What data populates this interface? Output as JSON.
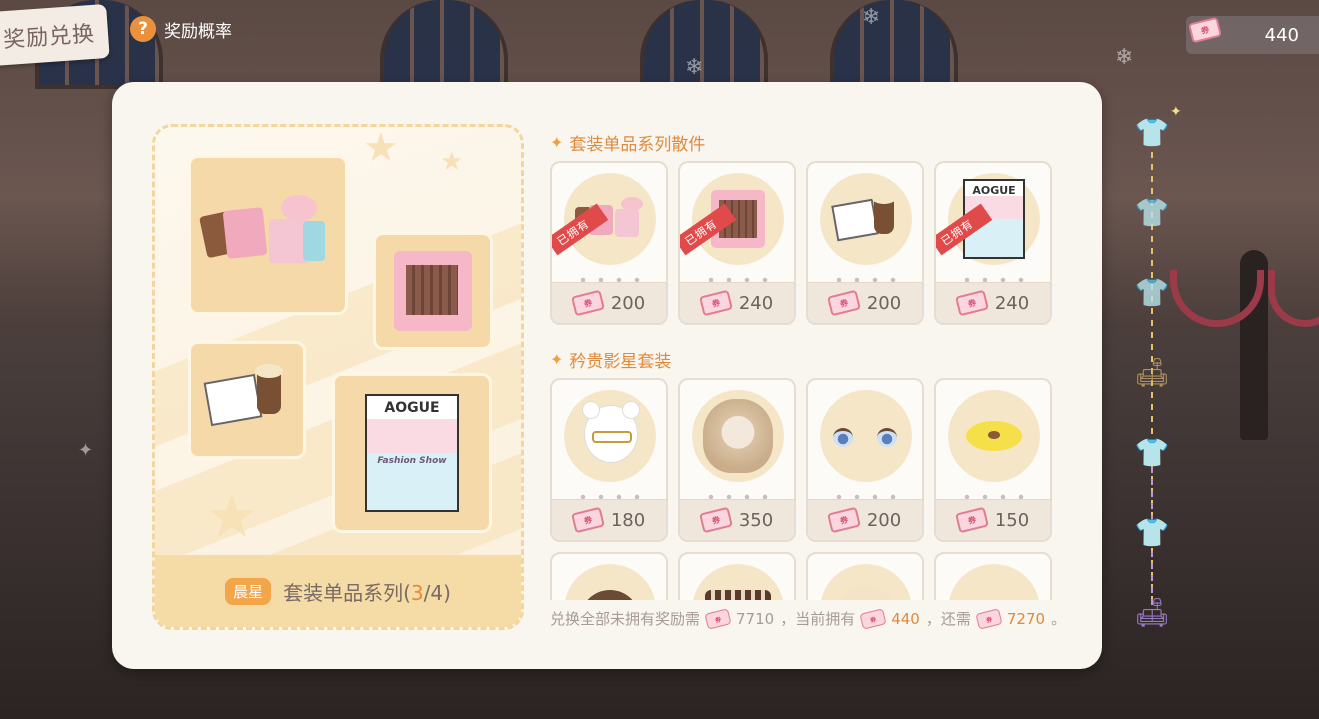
{
  "header": {
    "title": "奖励兑换",
    "help_label": "奖励概率",
    "currency_value": "440"
  },
  "preview": {
    "badge": "晨星",
    "set_name": "套装单品系列(",
    "set_owned": "3",
    "set_sep": "/",
    "set_total": "4",
    "set_close": ")",
    "magazine_title": "AOGUE",
    "magazine_sub": "Fashion Show"
  },
  "section1": {
    "title": "套装单品系列散件",
    "items": [
      {
        "price": "200",
        "owned": true,
        "icon": "shopping-bags-icon"
      },
      {
        "price": "240",
        "owned": true,
        "icon": "wardrobe-box-icon"
      },
      {
        "price": "200",
        "owned": false,
        "icon": "magazine-coffee-icon"
      },
      {
        "price": "240",
        "owned": true,
        "icon": "magazine-icon"
      }
    ]
  },
  "section2": {
    "title": "矜贵影星套装",
    "items": [
      {
        "price": "180",
        "icon": "bear-mask-icon"
      },
      {
        "price": "350",
        "icon": "curly-hair-icon"
      },
      {
        "price": "200",
        "icon": "eyes-makeup-icon"
      },
      {
        "price": "150",
        "icon": "duck-face-icon"
      },
      {
        "price": "",
        "icon": "hat-icon"
      },
      {
        "price": "",
        "icon": "drum-hat-icon"
      },
      {
        "price": "",
        "icon": "bear-icon"
      },
      {
        "price": "",
        "icon": "glasses-icon"
      }
    ]
  },
  "owned_label": "已拥有",
  "summary": {
    "prefix": "兑换全部未拥有奖励需",
    "need": "7710",
    "mid": "，当前拥有",
    "have": "440",
    "mid2": "，还需",
    "remain": "7270",
    "suffix": "。"
  },
  "ticket_text": "券",
  "colors": {
    "accent": "#e08a3c",
    "panel": "#f9f6ef",
    "owned_ribbon": "#e14a4a",
    "gold": "#f3c45a",
    "purple": "#9a7ac4"
  }
}
